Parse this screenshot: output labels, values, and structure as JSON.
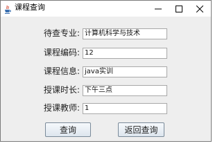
{
  "window": {
    "title": "课程查询",
    "controls": {
      "minimize": "minimize-icon",
      "maximize": "maximize-icon",
      "close": "close-icon"
    },
    "app_icon": "java-coffee-icon"
  },
  "form": {
    "fields": [
      {
        "label": "待查专业:",
        "value": "计算机科学与技术"
      },
      {
        "label": "课程编码:",
        "value": "12"
      },
      {
        "label": "课程信息:",
        "value": "java实训"
      },
      {
        "label": "授课时长:",
        "value": "下午三点"
      },
      {
        "label": "授课教师:",
        "value": "1"
      }
    ]
  },
  "buttons": {
    "query_label": "查询",
    "back_label": "返回查询"
  },
  "colors": {
    "window_bg": "#eeeeee",
    "titlebar_bg": "#ffffff",
    "button_border": "#7a8a99"
  }
}
